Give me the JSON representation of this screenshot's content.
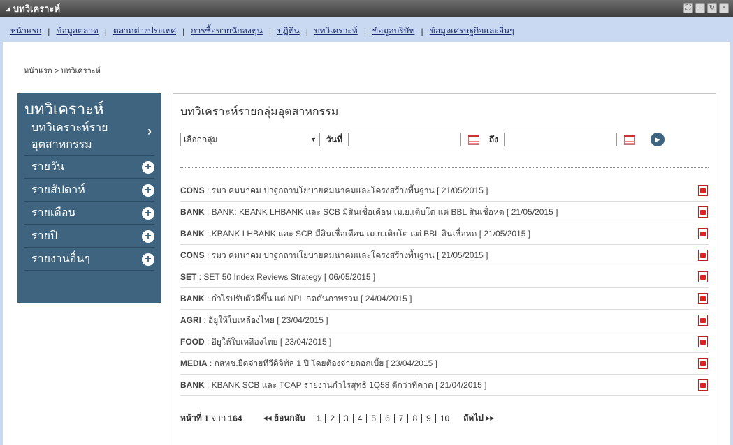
{
  "window": {
    "title": "บทวิเคราะห์"
  },
  "nav": {
    "items": [
      "หน้าแรก",
      "ข้อมูลตลาด",
      "ตลาดต่างประเทศ",
      "การซื้อขายนักลงทุน",
      "ปฏิทิน",
      "บทวิเคราะห์",
      "ข้อมูลบริษัท",
      "ข้อมูลเศรษฐกิจและอื่นๆ"
    ]
  },
  "breadcrumb": "หน้าแรก > บทวิเคราะห์",
  "sidebar": {
    "title": "บทวิเคราะห์",
    "active_line1": "บทวิเคราะห์ราย",
    "active_line2": "อุตสาหกรรม",
    "items": [
      "รายวัน",
      "รายสัปดาห์",
      "รายเดือน",
      "รายปี",
      "รายงานอื่นๆ"
    ]
  },
  "content": {
    "title": "บทวิเคราะห์รายกลุ่มอุตสาหกรรม",
    "select_value": "เลือกกลุ่ม",
    "date_label": "วันที่",
    "to_label": "ถึง"
  },
  "articles": [
    {
      "sector": "CONS",
      "text": " : รมว คมนาคม ปาฐกถานโยบายคมนาคมและโครงสร้างพื้นฐาน [ 21/05/2015 ]"
    },
    {
      "sector": "BANK",
      "text": " : BANK: KBANK LHBANK และ SCB มีสินเชื่อเดือน เม.ย.เติบโต แต่ BBL สินเชื่อหด [ 21/05/2015 ]"
    },
    {
      "sector": "BANK",
      "text": " : KBANK LHBANK และ SCB มีสินเชื่อเดือน เม.ย.เติบโต แต่ BBL สินเชื่อหด [ 21/05/2015 ]"
    },
    {
      "sector": "CONS",
      "text": " : รมว คมนาคม ปาฐกถานโยบายคมนาคมและโครงสร้างพื้นฐาน [ 21/05/2015 ]"
    },
    {
      "sector": "SET",
      "text": " : SET 50 Index Reviews Strategy [ 06/05/2015 ]"
    },
    {
      "sector": "BANK",
      "text": " : กำไรปรับตัวดีขึ้น แต่ NPL กดดันภาพรวม [ 24/04/2015 ]"
    },
    {
      "sector": "AGRI",
      "text": " : อียูให้ใบเหลืองไทย [ 23/04/2015 ]"
    },
    {
      "sector": "FOOD",
      "text": " : อียูให้ใบเหลืองไทย [ 23/04/2015 ]"
    },
    {
      "sector": "MEDIA",
      "text": " : กสทช.ยืดจ่ายทีวีดิจิทัล 1 ปี โดยต้องจ่ายดอกเบี้ย [ 23/04/2015 ]"
    },
    {
      "sector": "BANK",
      "text": " : KBANK SCB และ TCAP รายงานกำไรสุทธิ 1Q58 ดีกว่าที่คาด [ 21/04/2015 ]"
    }
  ],
  "pager": {
    "page_prefix": "หน้าที่",
    "current": "1",
    "of": "จาก",
    "total": "164",
    "prev": "◂◂ ย้อนกลับ",
    "pages": [
      "1",
      "2",
      "3",
      "4",
      "5",
      "6",
      "7",
      "8",
      "9",
      "10"
    ],
    "next": "ถัดไป ▸▸"
  }
}
